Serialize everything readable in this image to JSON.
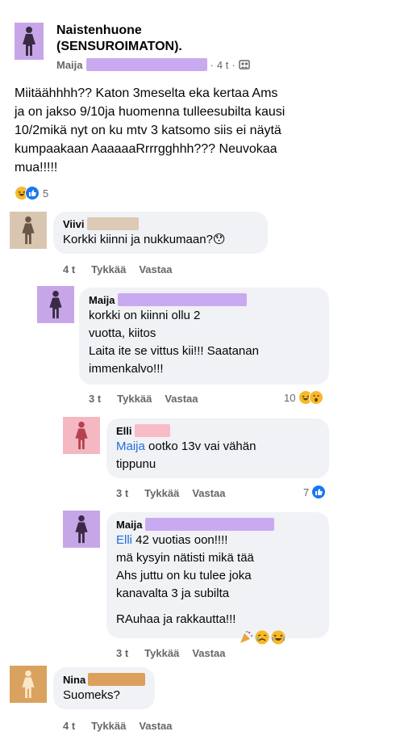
{
  "post": {
    "group_name": "Naistenhuone\n(SENSUROIMATON).",
    "author": "Maija",
    "time": "4 t",
    "body": "Miitäähhhh?? Katon 3meselta eka kertaa Ams\nja on jakso 9/10ja huomenna tulleesubilta kausi\n10/2mikä nyt on ku mtv 3 katsomo siis ei näytä\nkumpaakaan AaaaaaRrrrgghhh??? Neuvokaa\nmua!!!!!",
    "reaction_count": "5",
    "colors": {
      "avatar": "#c7a6e8",
      "redact": "#c9aaf0"
    }
  },
  "comments": [
    {
      "name": "Viivi",
      "text": "Korkki kiinni ja nukkumaan?😯",
      "time": "4 t",
      "like": "Tykkää",
      "reply": "Vastaa",
      "colors": {
        "avatar": "#d9c6b1",
        "redact": "#dccab6"
      }
    },
    {
      "name": "Maija",
      "text": "korkki on kiinni ollu 2\nvuotta, kiitos\nLaita ite se vittus kii!!! Saatanan\nimmenkalvo!!!",
      "time": "3 t",
      "like": "Tykkää",
      "reply": "Vastaa",
      "reaction_count": "10",
      "colors": {
        "avatar": "#c7a6e8",
        "redact": "#c9aaf0"
      }
    },
    {
      "name": "Elli",
      "mention": "Maija",
      "text": " ootko 13v vai vähän\ntippunu",
      "time": "3 t",
      "like": "Tykkää",
      "reply": "Vastaa",
      "reaction_count": "7",
      "colors": {
        "avatar": "#f5b8c2",
        "redact": "#f8bcc6"
      }
    },
    {
      "name": "Maija",
      "mention": "Elli",
      "text": " 42 vuotias oon!!!!\nmä kysyin nätisti mikä tää\nAhs juttu on ku tulee joka\nkanavalta 3 ja subilta",
      "text2": "RAuhaa ja rakkautta!!!",
      "time": "3 t",
      "like": "Tykkää",
      "reply": "Vastaa",
      "colors": {
        "avatar": "#c7a6e8",
        "redact": "#c9aaf0"
      }
    },
    {
      "name": "Nina",
      "text": "Suomeks?",
      "time": "4 t",
      "like": "Tykkää",
      "reply": "Vastaa",
      "colors": {
        "avatar": "#d9a25e",
        "redact": "#dca05c"
      }
    }
  ],
  "icons": {
    "avatar": "woman-silhouette-icon",
    "globe": "group-privacy-icon",
    "like": "like-reaction-icon",
    "haha": "haha-reaction-icon",
    "wow": "wow-reaction-icon"
  }
}
